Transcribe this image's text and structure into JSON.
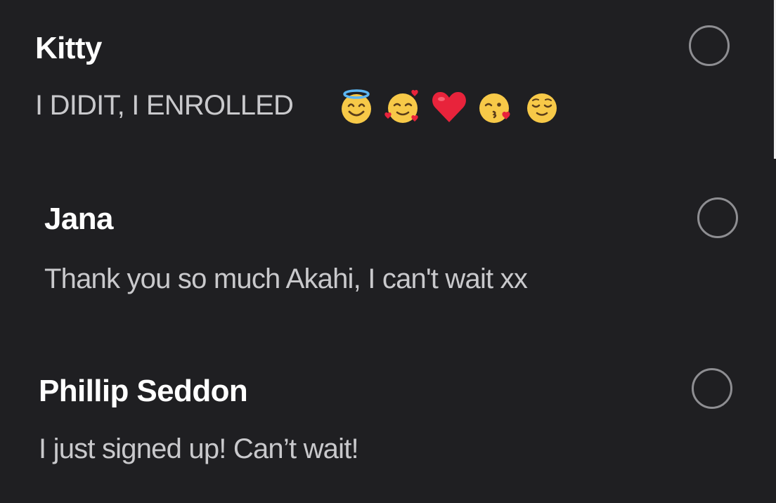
{
  "comments": [
    {
      "author": "Kitty",
      "text": "I DIDIT, I ENROLLED",
      "emojis": [
        "smiling-face-with-halo",
        "smiling-face-with-hearts",
        "red-heart",
        "face-blowing-kiss",
        "relieved-face"
      ]
    },
    {
      "author": "Jana",
      "text": "Thank you so much Akahi, I can't wait xx"
    },
    {
      "author": "Phillip Seddon",
      "text": "I just signed up! Can’t wait!"
    }
  ],
  "colors": {
    "background": "#1f1f22",
    "author": "#ffffff",
    "text": "#c9c9cc",
    "radio_border": "#8e8e92"
  }
}
